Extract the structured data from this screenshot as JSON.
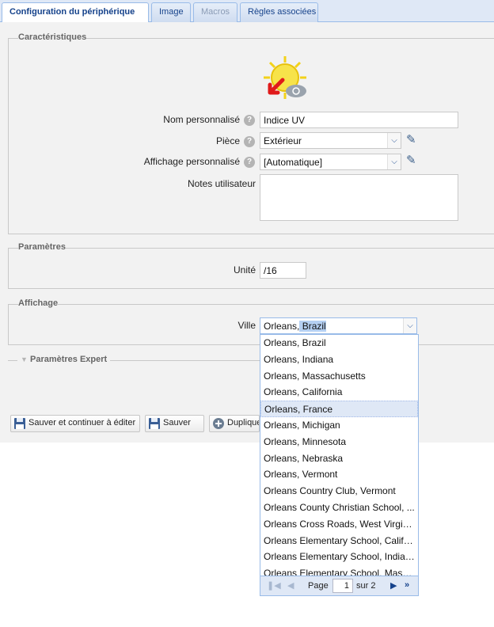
{
  "tabs": [
    {
      "label": "Configuration du périphérique",
      "state": "active"
    },
    {
      "label": "Image",
      "state": "normal"
    },
    {
      "label": "Macros",
      "state": "disabled"
    },
    {
      "label": "Règles associées",
      "state": "normal"
    }
  ],
  "caracteristiques": {
    "legend": "Caractéristiques",
    "device_icon": "uv-sun-cloud-icon",
    "nom_label": "Nom personnalisé",
    "nom_value": "Indice UV",
    "piece_label": "Pièce",
    "piece_value": "Extérieur",
    "affichage_label": "Affichage personnalisé",
    "affichage_value": "[Automatique]",
    "notes_label": "Notes utilisateur",
    "notes_value": ""
  },
  "parametres": {
    "legend": "Paramètres",
    "unite_label": "Unité",
    "unite_value": "/16"
  },
  "affichage": {
    "legend": "Affichage",
    "ville_label": "Ville",
    "ville_value_prefix": "Orleans,",
    "ville_value_selected": " Brazil"
  },
  "expert": {
    "legend": "Paramètres Expert"
  },
  "buttons": {
    "save_continue": "Sauver et continuer à éditer",
    "save": "Sauver",
    "duplicate": "Dupliquer"
  },
  "dropdown": {
    "items": [
      "Orleans, Brazil",
      "Orleans, Indiana",
      "Orleans, Massachusetts",
      "Orleans, California",
      "Orleans, France",
      "Orleans, Michigan",
      "Orleans, Minnesota",
      "Orleans, Nebraska",
      "Orleans, Vermont",
      "Orleans Country Club, Vermont",
      "Orleans County Christian School, ...",
      "Orleans Cross Roads, West Virginia",
      "Orleans Elementary School, Califo...",
      "Orleans Elementary School, Indiana",
      "Orleans Elementary School, Mass..."
    ],
    "highlighted_index": 4,
    "pager": {
      "page_label": "Page",
      "page_value": "1",
      "of_label": "sur 2"
    }
  },
  "colors": {
    "tab_border": "#99bbe8",
    "tab_text": "#15428b",
    "panel_bg": "#f2f2f2",
    "highlight": "#dfe8f6"
  }
}
